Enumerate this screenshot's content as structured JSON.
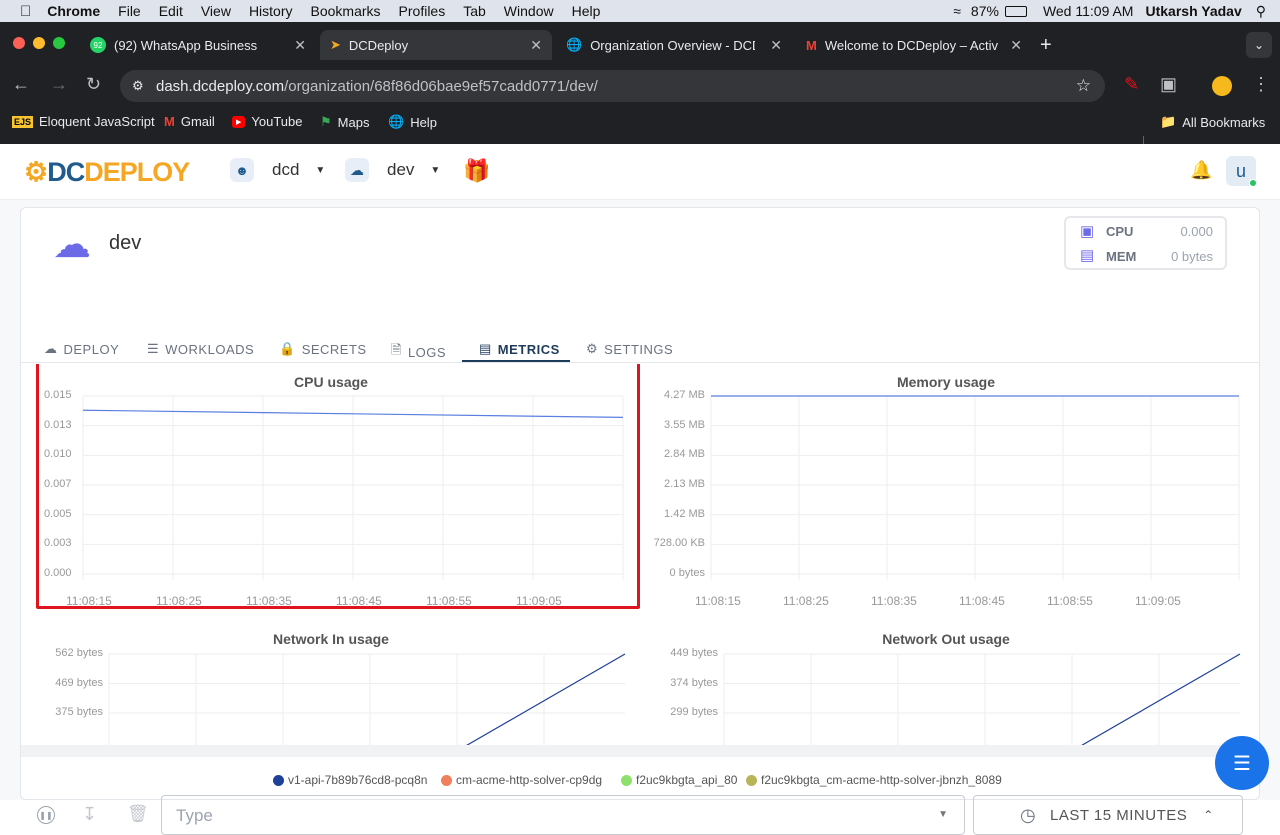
{
  "menubar": {
    "app": "Chrome",
    "items": [
      "File",
      "Edit",
      "View",
      "History",
      "Bookmarks",
      "Profiles",
      "Tab",
      "Window",
      "Help"
    ],
    "battery": "87%",
    "clock": "Wed 11:09 AM",
    "user": "Utkarsh Yadav"
  },
  "tabs": [
    {
      "title": "(92) WhatsApp Business",
      "badge": "92"
    },
    {
      "title": "DCDeploy"
    },
    {
      "title": "Organization Overview - DCD"
    },
    {
      "title": "Welcome to DCDeploy – Activ"
    }
  ],
  "address": {
    "host": "dash.dcdeploy.com",
    "path": "/organization/68f86d06bae9ef57cadd0771/dev/"
  },
  "bookmarks": [
    "Eloquent JavaScript",
    "Gmail",
    "YouTube",
    "Maps",
    "Help"
  ],
  "all_bookmarks": "All Bookmarks",
  "header": {
    "logo_a": "DC",
    "logo_b": "DEPLOY",
    "org": "dcd",
    "env": "dev",
    "avatar": "u"
  },
  "project": {
    "name": "dev",
    "cpu_label": "CPU",
    "cpu_value": "0.000",
    "mem_label": "MEM",
    "mem_value": "0 bytes"
  },
  "content_tabs": [
    "DEPLOY",
    "WORKLOADS",
    "SECRETS",
    "LOGS",
    "METRICS",
    "SETTINGS"
  ],
  "active_tab": "METRICS",
  "footer": {
    "type_placeholder": "Type",
    "range": "LAST 15 MINUTES"
  },
  "colors": {
    "line": "#5b7fe0",
    "highlight": "#e0141e",
    "accent": "#1f3b5c"
  },
  "chart_data": [
    {
      "type": "line",
      "title": "CPU usage",
      "x": [
        "11:08:15",
        "11:08:25",
        "11:08:35",
        "11:08:45",
        "11:08:55",
        "11:09:05"
      ],
      "y_ticks": [
        "0.015",
        "0.013",
        "0.010",
        "0.007",
        "0.005",
        "0.003",
        "0.000"
      ],
      "series": [
        {
          "points": [
            [
              0,
              0.0138
            ],
            [
              6,
              0.0132
            ]
          ]
        }
      ],
      "ylim": [
        0,
        0.015
      ]
    },
    {
      "type": "line",
      "title": "Memory usage",
      "x": [
        "11:08:15",
        "11:08:25",
        "11:08:35",
        "11:08:45",
        "11:08:55",
        "11:09:05"
      ],
      "y_ticks": [
        "4.27 MB",
        "3.55 MB",
        "2.84 MB",
        "2.13 MB",
        "1.42 MB",
        "728.00 KB",
        "0 bytes"
      ],
      "series": [
        {
          "points": [
            [
              0,
              4.27
            ],
            [
              6,
              4.27
            ]
          ]
        }
      ],
      "ylim": [
        0,
        4.27
      ]
    },
    {
      "type": "line",
      "title": "Network In usage",
      "y_ticks": [
        "562 bytes",
        "469 bytes",
        "375 bytes"
      ],
      "series": [
        {
          "points": [
            [
              3.2,
              340
            ],
            [
              6,
              562
            ]
          ]
        }
      ],
      "ylim": [
        340,
        562
      ]
    },
    {
      "type": "line",
      "title": "Network Out usage",
      "y_ticks": [
        "449 bytes",
        "374 bytes",
        "299 bytes"
      ],
      "series": [
        {
          "points": [
            [
              3.2,
              270
            ],
            [
              6,
              449
            ]
          ]
        }
      ],
      "ylim": [
        270,
        449
      ]
    }
  ],
  "legend": [
    {
      "name": "v1-api-7b89b76cd8-pcq8n",
      "color": "#1e3f9a"
    },
    {
      "name": "cm-acme-http-solver-cp9dg",
      "color": "#f07f5b"
    },
    {
      "name": "f2uc9kbgta_api_80",
      "color": "#8ee06c"
    },
    {
      "name": "f2uc9kbgta_cm-acme-http-solver-jbnzh_8089",
      "color": "#b8b45a"
    }
  ]
}
